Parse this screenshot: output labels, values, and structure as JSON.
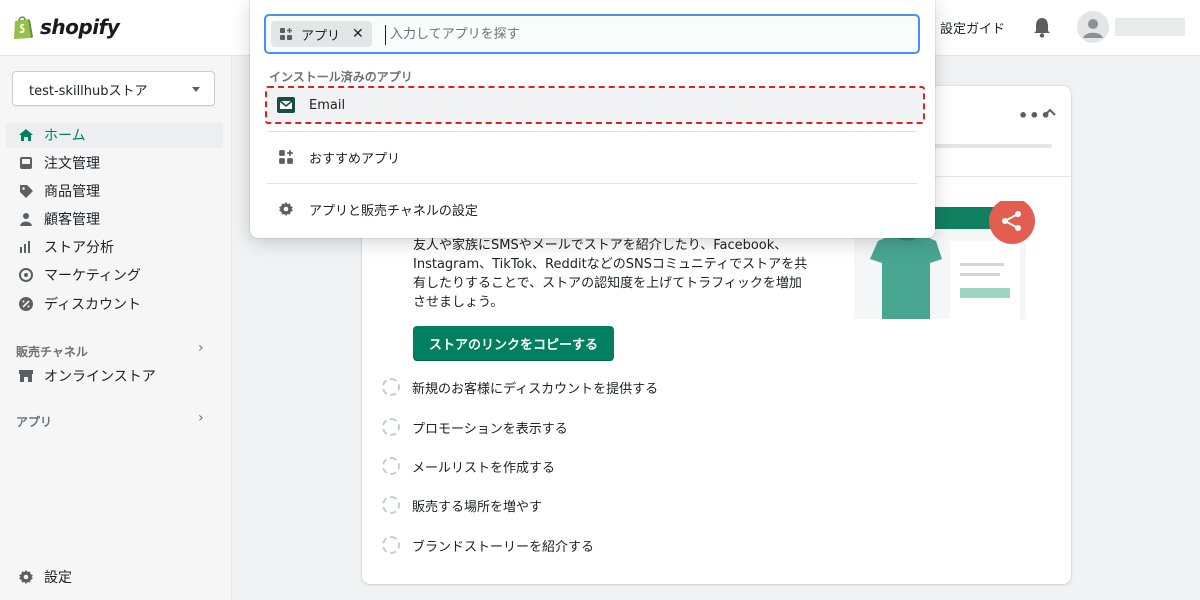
{
  "topbar": {
    "logo_text": "shopify",
    "setup_guide": "設定ガイド"
  },
  "sidebar": {
    "store_name": "test-skillhubストア",
    "items": [
      {
        "label": "ホーム",
        "icon": "home-icon",
        "active": true
      },
      {
        "label": "注文管理",
        "icon": "inbox-icon"
      },
      {
        "label": "商品管理",
        "icon": "tag-icon"
      },
      {
        "label": "顧客管理",
        "icon": "person-icon"
      },
      {
        "label": "ストア分析",
        "icon": "bar-chart-icon"
      },
      {
        "label": "マーケティング",
        "icon": "target-icon"
      },
      {
        "label": "ディスカウント",
        "icon": "discount-icon"
      }
    ],
    "sales_channels_label": "販売チャネル",
    "online_store_label": "オンラインストア",
    "apps_label": "アプリ",
    "settings_label": "設定"
  },
  "popover": {
    "chip_label": "アプリ",
    "search_placeholder": "入力してアプリを探す",
    "section_label": "インストール済みのアプリ",
    "items": [
      {
        "label": "Email",
        "icon": "email-app-icon"
      },
      {
        "label": "おすすめアプリ",
        "icon": "apps-grid-icon"
      },
      {
        "label": "アプリと販売チャネルの設定",
        "icon": "gear-icon"
      }
    ]
  },
  "card": {
    "description": "友人や家族にSMSやメールでストアを紹介したり、Facebook、Instagram、TikTok、RedditなどのSNSコミュニティでストアを共有したりすることで、ストアの認知度を上げてトラフィックを増加させましょう。",
    "copy_button": "ストアのリンクをコピーする",
    "tasks": [
      "新規のお客様にディスカウントを提供する",
      "プロモーションを表示する",
      "メールリストを作成する",
      "販売する場所を増やす",
      "ブランドストーリーを紹介する"
    ]
  },
  "colors": {
    "accent": "#008060",
    "focus": "#458fff",
    "highlight_outline": "#e01f1f",
    "share_button": "#e35e4f"
  }
}
